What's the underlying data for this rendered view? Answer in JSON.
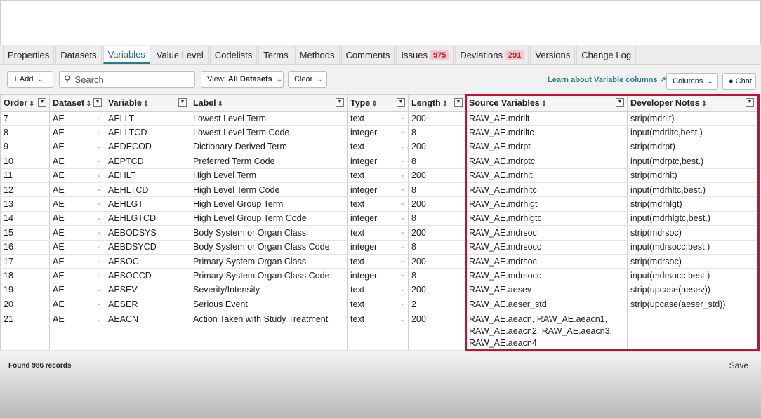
{
  "tabs": [
    {
      "label": "Properties"
    },
    {
      "label": "Datasets"
    },
    {
      "label": "Variables"
    },
    {
      "label": "Value Level"
    },
    {
      "label": "Codelists"
    },
    {
      "label": "Terms"
    },
    {
      "label": "Methods"
    },
    {
      "label": "Comments"
    },
    {
      "label": "Issues",
      "badge": "975"
    },
    {
      "label": "Deviations",
      "badge": "291"
    },
    {
      "label": "Versions"
    },
    {
      "label": "Change Log"
    }
  ],
  "toolbar": {
    "add_label": "+ Add",
    "search_placeholder": "Search",
    "view_prefix": "View:",
    "view_value": "All Datasets",
    "clear_label": "Clear",
    "learn_link": "Learn about Variable columns",
    "columns_label": "Columns",
    "chat_label": "Chat"
  },
  "table": {
    "headers": [
      "Order",
      "Dataset",
      "Variable",
      "Label",
      "Type",
      "Length",
      "Source Variables",
      "Developer Notes"
    ],
    "rows": [
      [
        "7",
        "AE",
        "AELLT",
        "Lowest Level Term",
        "text",
        "200",
        "RAW_AE.mdrllt",
        "strip(mdrllt)"
      ],
      [
        "8",
        "AE",
        "AELLTCD",
        "Lowest Level Term Code",
        "integer",
        "8",
        "RAW_AE.mdrlltc",
        "input(mdrlltc,best.)"
      ],
      [
        "9",
        "AE",
        "AEDECOD",
        "Dictionary-Derived Term",
        "text",
        "200",
        "RAW_AE.mdrpt",
        "strip(mdrpt)"
      ],
      [
        "10",
        "AE",
        "AEPTCD",
        "Preferred Term Code",
        "integer",
        "8",
        "RAW_AE.mdrptc",
        "input(mdrptc,best.)"
      ],
      [
        "11",
        "AE",
        "AEHLT",
        "High Level Term",
        "text",
        "200",
        "RAW_AE.mdrhlt",
        "strip(mdrhlt)"
      ],
      [
        "12",
        "AE",
        "AEHLTCD",
        "High Level Term Code",
        "integer",
        "8",
        "RAW_AE.mdrhltc",
        "input(mdrhltc,best.)"
      ],
      [
        "13",
        "AE",
        "AEHLGT",
        "High Level Group Term",
        "text",
        "200",
        "RAW_AE.mdrhlgt",
        "strip(mdrhlgt)"
      ],
      [
        "14",
        "AE",
        "AEHLGTCD",
        "High Level Group Term Code",
        "integer",
        "8",
        "RAW_AE.mdrhlgtc",
        "input(mdrhlgtc,best.)"
      ],
      [
        "15",
        "AE",
        "AEBODSYS",
        "Body System or Organ Class",
        "text",
        "200",
        "RAW_AE.mdrsoc",
        "strip(mdrsoc)"
      ],
      [
        "16",
        "AE",
        "AEBDSYCD",
        "Body System or Organ Class Code",
        "integer",
        "8",
        "RAW_AE.mdrsocc",
        "input(mdrsocc,best.)"
      ],
      [
        "17",
        "AE",
        "AESOC",
        "Primary System Organ Class",
        "text",
        "200",
        "RAW_AE.mdrsoc",
        "strip(mdrsoc)"
      ],
      [
        "18",
        "AE",
        "AESOCCD",
        "Primary System Organ Class Code",
        "integer",
        "8",
        "RAW_AE.mdrsocc",
        "input(mdrsocc,best.)"
      ],
      [
        "19",
        "AE",
        "AESEV",
        "Severity/Intensity",
        "text",
        "200",
        "RAW_AE.aesev",
        "strip(upcase(aesev))"
      ],
      [
        "20",
        "AE",
        "AESER",
        "Serious Event",
        "text",
        "2",
        "RAW_AE.aeser_std",
        "strip(upcase(aeser_std))"
      ],
      [
        "21",
        "AE",
        "AEACN",
        "Action Taken with Study Treatment",
        "text",
        "200",
        "RAW_AE.aeacn, RAW_AE.aeacn1, RAW_AE.aeacn2, RAW_AE.aeacn3, RAW_AE.aeacn4",
        ""
      ]
    ]
  },
  "footer": {
    "found": "Found 986 records",
    "save_label": "Save"
  },
  "colors": {
    "accent": "#1e7d8f",
    "highlight": "#c8102e",
    "badge_text": "#c01f33"
  }
}
